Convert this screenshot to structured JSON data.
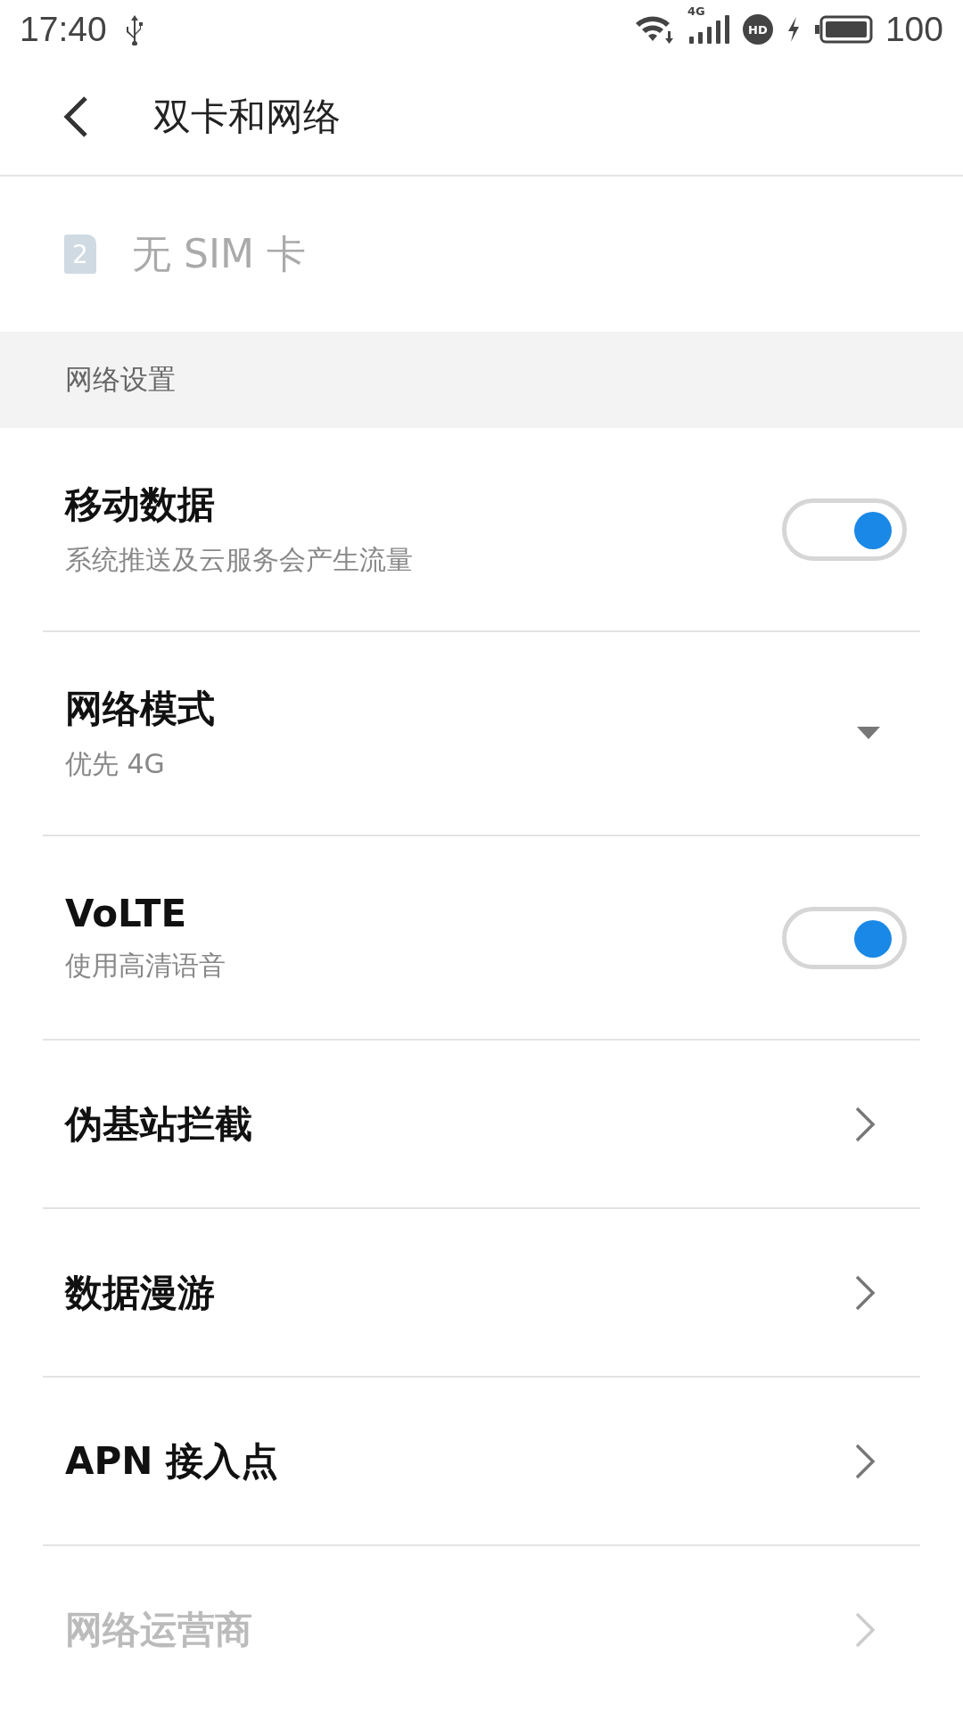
{
  "status_bar": {
    "time": "17:40",
    "network_type": "4G",
    "hd_label": "HD",
    "battery": "100"
  },
  "header": {
    "title": "双卡和网络"
  },
  "sim": {
    "slot": "2",
    "label": "无 SIM 卡",
    "disabled": true
  },
  "section": {
    "title": "网络设置"
  },
  "items": [
    {
      "kind": "toggle",
      "title": "移动数据",
      "subtitle": "系统推送及云服务会产生流量",
      "on": true,
      "disabled": false
    },
    {
      "kind": "dropdown",
      "title": "网络模式",
      "subtitle": "优先 4G",
      "disabled": false
    },
    {
      "kind": "toggle",
      "title": "VoLTE",
      "subtitle": "使用高清语音",
      "on": true,
      "disabled": false
    },
    {
      "kind": "link",
      "title": "伪基站拦截",
      "disabled": false
    },
    {
      "kind": "link",
      "title": "数据漫游",
      "disabled": false
    },
    {
      "kind": "link",
      "title": "APN 接入点",
      "disabled": false
    },
    {
      "kind": "link",
      "title": "网络运营商",
      "disabled": true
    }
  ]
}
